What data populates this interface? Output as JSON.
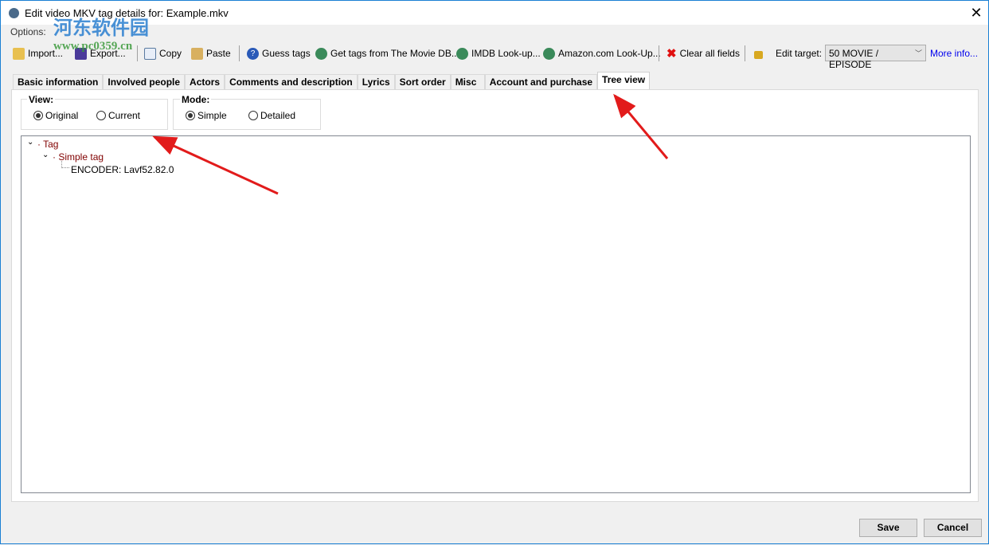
{
  "window": {
    "title": "Edit video MKV tag details for: Example.mkv",
    "close": "✕"
  },
  "watermark": {
    "line1": "河东软件园",
    "line2": "www.pc0359.cn"
  },
  "options_label": "Options:",
  "toolbar": {
    "import": "Import...",
    "export": "Export...",
    "copy": "Copy",
    "paste": "Paste",
    "guess": "Guess tags",
    "moviedb": "Get tags from The Movie DB...",
    "imdb": "IMDB Look-up...",
    "amazon": "Amazon.com Look-Up...",
    "clear": "Clear all fields",
    "edit_target_label": "Edit target:",
    "edit_target_value": "50 MOVIE / EPISODE",
    "more_info": "More info..."
  },
  "tabs": [
    "Basic information",
    "Involved people",
    "Actors",
    "Comments and description",
    "Lyrics",
    "Sort order",
    "Misc",
    "Account and purchase",
    "Tree view"
  ],
  "view": {
    "label": "View:",
    "options": [
      "Original",
      "Current"
    ],
    "selected": "Original"
  },
  "mode": {
    "label": "Mode:",
    "options": [
      "Simple",
      "Detailed"
    ],
    "selected": "Simple"
  },
  "tree": {
    "root": "Tag",
    "child": "Simple tag",
    "leaf": "ENCODER: Lavf52.82.0"
  },
  "buttons": {
    "save": "Save",
    "cancel": "Cancel"
  }
}
